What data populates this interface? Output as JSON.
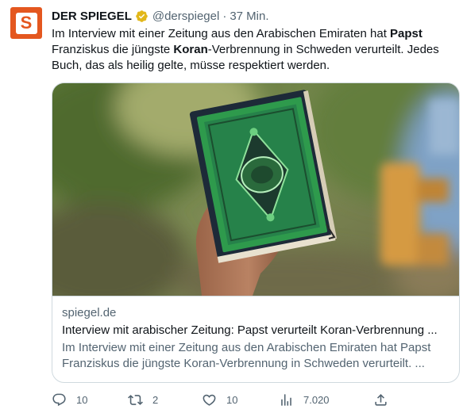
{
  "account": {
    "avatar_letter": "S",
    "name": "DER SPIEGEL",
    "handle": "@derspiegel",
    "separator": "·",
    "time": "37 Min."
  },
  "tweet": {
    "seg1": "Im Interview mit einer Zeitung aus den Arabischen Emiraten hat ",
    "bold1": "Papst",
    "seg2": " Franziskus die jüngste ",
    "bold2": "Koran",
    "seg3": "-Verbrennung in Schweden verurteilt. Jedes Buch, das als heilig gelte, müsse respektiert werden."
  },
  "card": {
    "domain": "spiegel.de",
    "title": "Interview mit arabischer Zeitung: Papst verurteilt Koran-Verbrennung ...",
    "description": "Im Interview mit einer Zeitung aus den Arabischen Emiraten hat Papst Franziskus die jüngste Koran-Verbrennung in Schweden verurteilt. ..."
  },
  "actions": {
    "replies": "10",
    "retweets": "2",
    "likes": "10",
    "views": "7.020"
  },
  "colors": {
    "brand": "#e4571f",
    "verified": "#e2b719",
    "muted": "#536471",
    "text": "#0f1419",
    "border": "#cfd9de"
  }
}
